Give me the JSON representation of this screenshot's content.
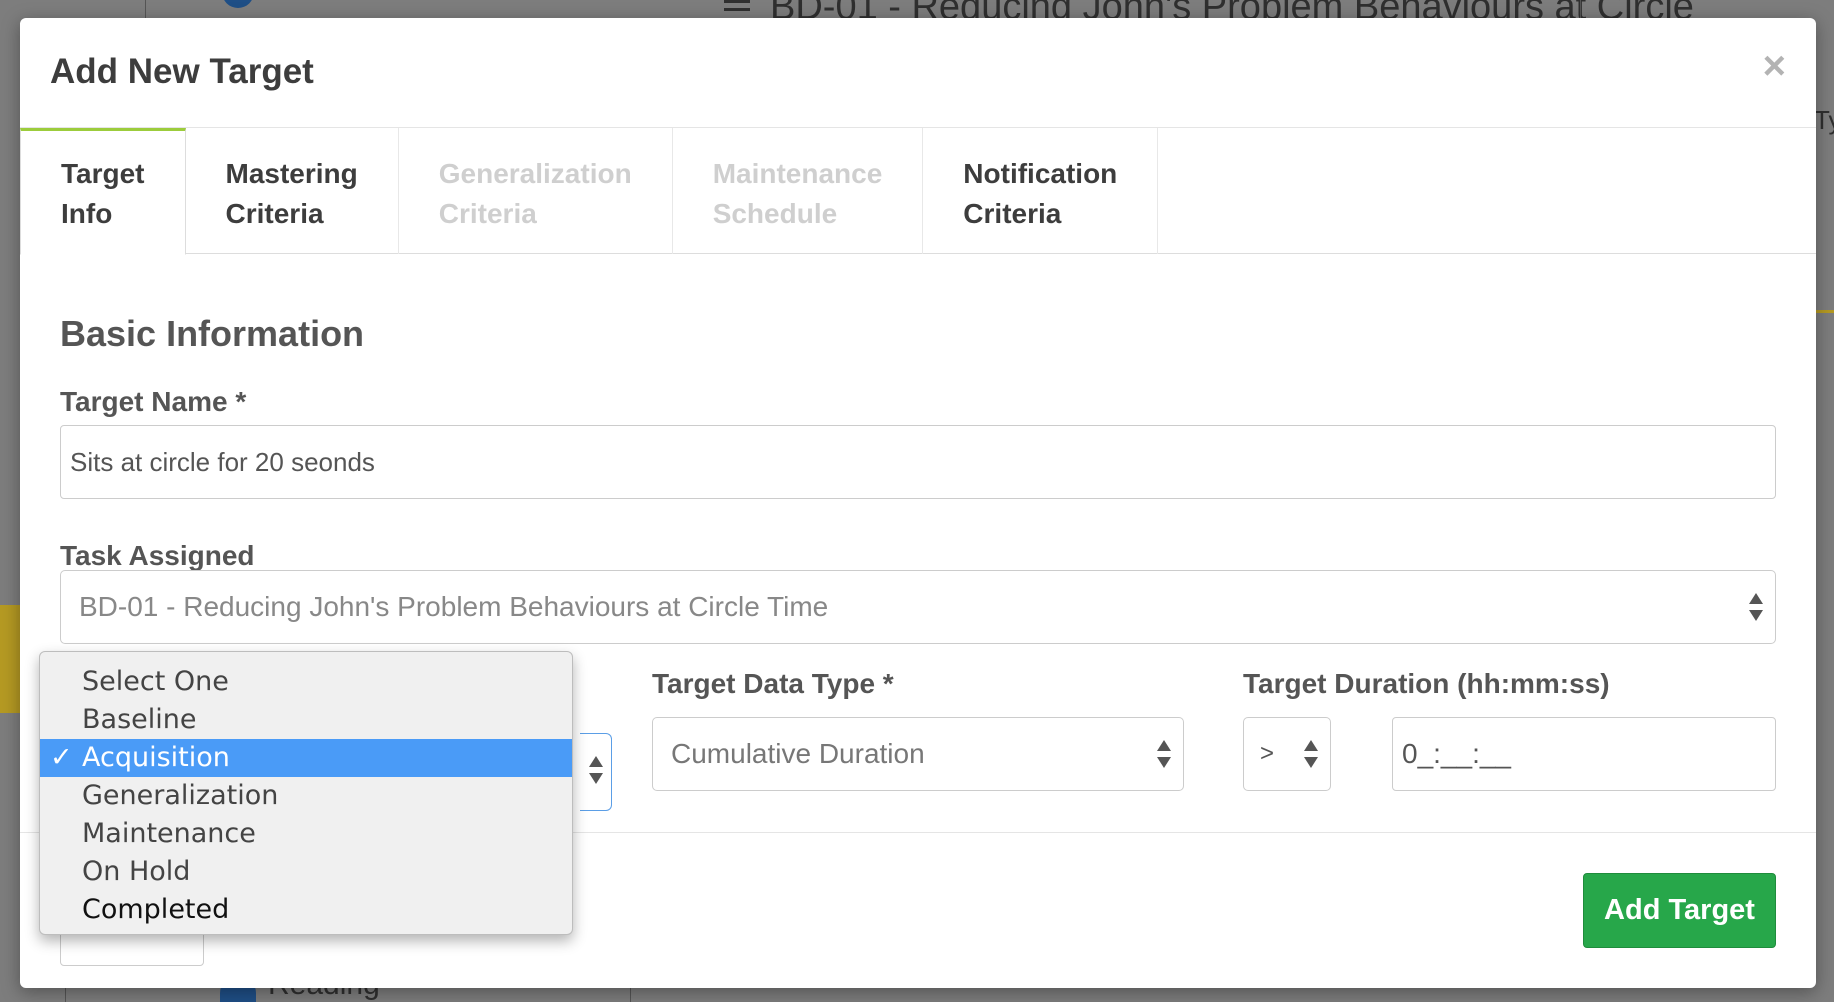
{
  "background": {
    "page_title": "BD-01 - Reducing John's Problem Behaviours at Circle",
    "sidebar_item": "Reading",
    "edge_text": "Ty"
  },
  "modal": {
    "title": "Add New Target",
    "close_label": "×"
  },
  "tabs": [
    {
      "label": "Target\nInfo",
      "state": "active"
    },
    {
      "label": "Mastering\nCriteria",
      "state": "enabled"
    },
    {
      "label": "Generalization\nCriteria",
      "state": "disabled"
    },
    {
      "label": "Maintenance\nSchedule",
      "state": "disabled"
    },
    {
      "label": "Notification\nCriteria",
      "state": "enabled"
    }
  ],
  "form": {
    "section_title": "Basic Information",
    "target_name": {
      "label": "Target Name *",
      "value": "Sits at circle for 20 seonds"
    },
    "task_assigned": {
      "label": "Task Assigned",
      "value": "BD-01 - Reducing John's Problem Behaviours at Circle Time"
    },
    "target_data_type": {
      "label": "Target Data Type *",
      "value": "Cumulative Duration"
    },
    "target_duration": {
      "label": "Target Duration (hh:mm:ss)",
      "operator": ">",
      "value": "0_:__:__"
    }
  },
  "status_dropdown": {
    "selected": "Acquisition",
    "check_mark": "✓",
    "options": [
      "Select One",
      "Baseline",
      "Acquisition",
      "Generalization",
      "Maintenance",
      "On Hold",
      "Completed"
    ]
  },
  "footer": {
    "add_button": "Add Target"
  },
  "colors": {
    "primary_green": "#27a74a",
    "tab_accent": "#9ccc3c",
    "selection_blue": "#4a9bf7"
  }
}
